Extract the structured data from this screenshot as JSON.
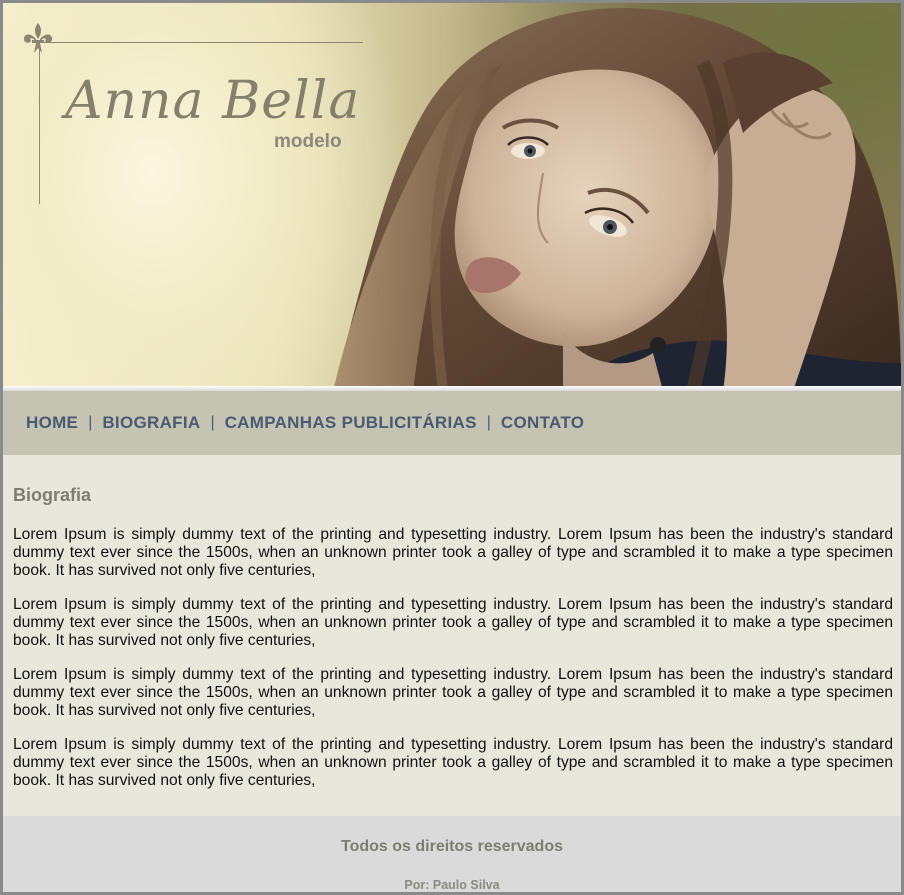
{
  "brand": {
    "name": "Anna Bella",
    "subtitle": "modelo",
    "logo_icon": "fleur-de-lis-icon"
  },
  "nav": {
    "items": [
      {
        "label": "HOME"
      },
      {
        "label": "BIOGRAFIA"
      },
      {
        "label": "CAMPANHAS PUBLICITÁRIAS"
      },
      {
        "label": "CONTATO"
      }
    ],
    "separator": "|"
  },
  "content": {
    "title": "Biografia",
    "paragraphs": [
      "Lorem Ipsum is simply dummy text of the printing and typesetting industry. Lorem Ipsum has been the industry's standard dummy text ever since the 1500s, when an unknown printer took a galley of type and scrambled it to make a type specimen book. It has survived not only five centuries,",
      "Lorem Ipsum is simply dummy text of the printing and typesetting industry. Lorem Ipsum has been the industry's standard dummy text ever since the 1500s, when an unknown printer took a galley of type and scrambled it to make a type specimen book. It has survived not only five centuries,",
      "Lorem Ipsum is simply dummy text of the printing and typesetting industry. Lorem Ipsum has been the industry's standard dummy text ever since the 1500s, when an unknown printer took a galley of type and scrambled it to make a type specimen book. It has survived not only five centuries,",
      "Lorem Ipsum is simply dummy text of the printing and typesetting industry. Lorem Ipsum has been the industry's standard dummy text ever since the 1500s, when an unknown printer took a galley of type and scrambled it to make a type specimen book. It has survived not only five centuries,"
    ]
  },
  "footer": {
    "rights": "Todos os direitos reservados",
    "author": "Por: Paulo Silva"
  },
  "colors": {
    "nav_background": "#c5c4b2",
    "nav_link": "#4a5a72",
    "content_background": "#e7e7dc",
    "footer_background": "#dadada",
    "heading": "#7d7d72"
  }
}
